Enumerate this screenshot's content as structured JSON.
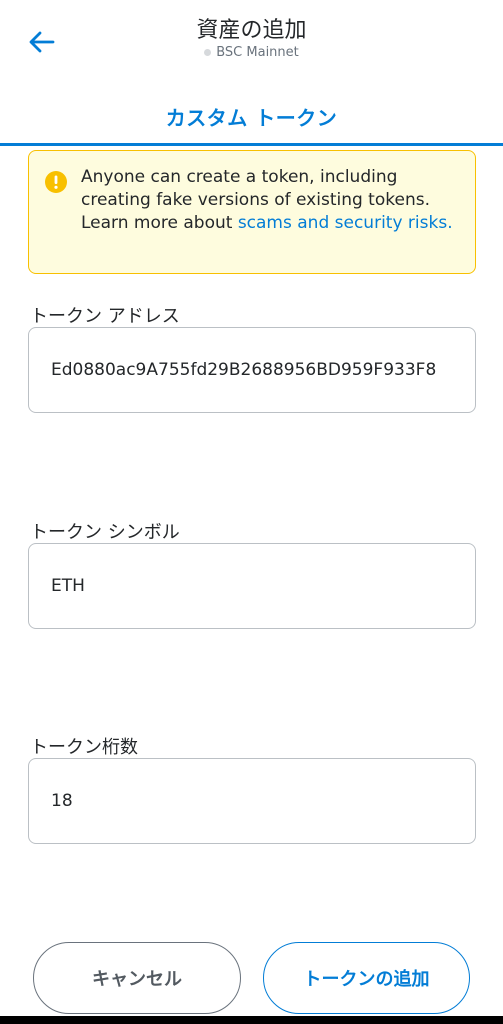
{
  "header": {
    "title": "資産の追加",
    "network": "BSC Mainnet"
  },
  "tab": {
    "label": "カスタム トークン"
  },
  "warning": {
    "text": "Anyone can create a token, including creating fake versions of existing tokens. Learn more about ",
    "link": "scams and security risks."
  },
  "fields": {
    "address": {
      "label": "トークン アドレス",
      "value": "Ed0880ac9A755fd29B2688956BD959F933F8"
    },
    "symbol": {
      "label": "トークン シンボル",
      "value": "ETH"
    },
    "decimals": {
      "label": "トークン桁数",
      "value": "18"
    }
  },
  "buttons": {
    "cancel": "キャンセル",
    "add": "トークンの追加"
  },
  "colors": {
    "accent": "#037dd6",
    "warning_bg": "#fefcde",
    "warning_border": "#f8c000"
  }
}
